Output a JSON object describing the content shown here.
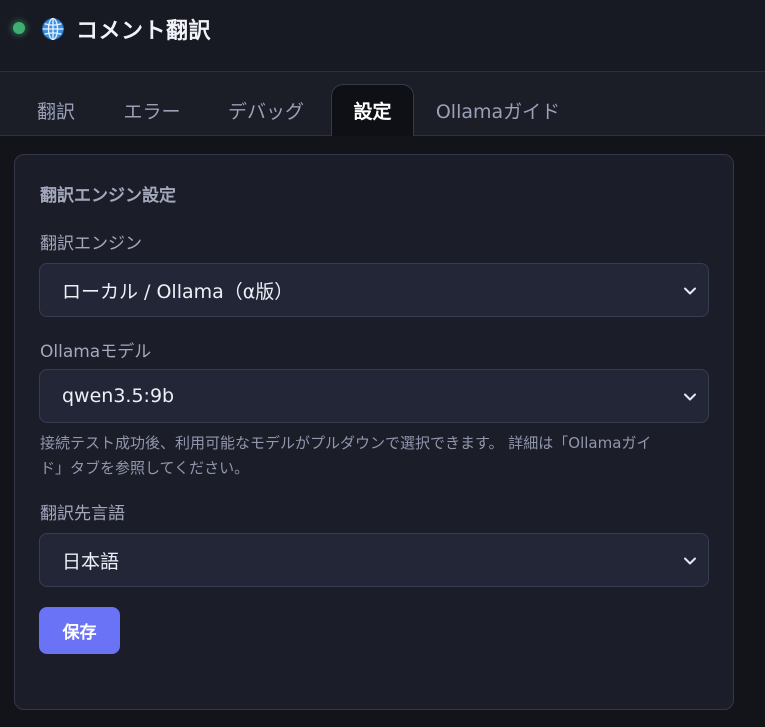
{
  "app": {
    "title": "コメント翻訳",
    "status_color": "#3fae6e"
  },
  "tabs": [
    {
      "label": "翻訳",
      "active": false
    },
    {
      "label": "エラー",
      "active": false
    },
    {
      "label": "デバッグ",
      "active": false
    },
    {
      "label": "設定",
      "active": true
    },
    {
      "label": "Ollamaガイド",
      "active": false
    }
  ],
  "settings": {
    "section_title": "翻訳エンジン設定",
    "engine": {
      "label": "翻訳エンジン",
      "value": "ローカル / Ollama（α版）"
    },
    "model": {
      "label": "Ollamaモデル",
      "value": "qwen3.5:9b",
      "help_line1": "接続テスト成功後、利用可能なモデルがプルダウンで選択できます。 詳細は「Ollamaガイ",
      "help_line2": "ド」タブを参照してください。"
    },
    "language": {
      "label": "翻訳先言語",
      "value": "日本語"
    },
    "save_label": "保存"
  },
  "icons": {
    "status": "status-dot",
    "globe": "globe-icon",
    "chevron": "chevron-down-icon"
  },
  "colors": {
    "accent": "#6a73f5",
    "background": "#131419",
    "card": "#1b1d28"
  }
}
